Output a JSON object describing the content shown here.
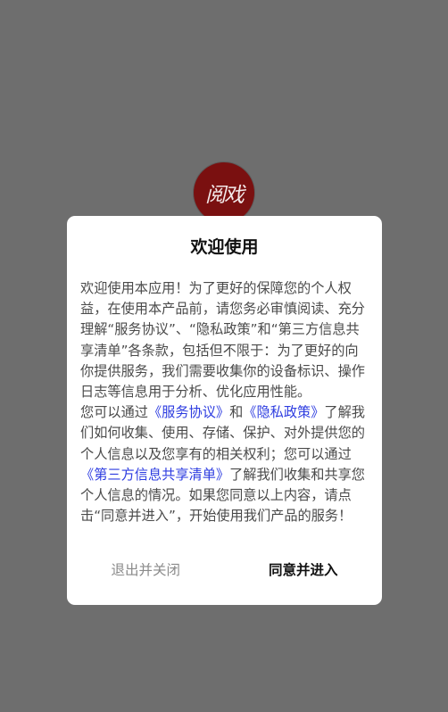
{
  "logo": {
    "text": "阅戏"
  },
  "dialog": {
    "title": "欢迎使用",
    "paragraph1": "欢迎使用本应用！为了更好的保障您的个人权益，在使用本产品前，请您务必审慎阅读、充分理解“服务协议”、“隐私政策”和“第三方信息共享清单”各条款，包括但不限于：为了更好的向你提供服务，我们需要收集你的设备标识、操作日志等信息用于分析、优化应用性能。",
    "p2_part1": "您可以通过",
    "link_service": "《服务协议》",
    "p2_part2": "和",
    "link_privacy": "《隐私政策》",
    "p2_part3": "了解我们如何收集、使用、存储、保护、对外提供您的个人信息以及您享有的相关权利；您可以通过",
    "link_third_party": "《第三方信息共享清单》",
    "p2_part4": "了解我们收集和共享您个人信息的情况。如果您同意以上内容，请点击“同意并进入”，开始使用我们产品的服务！",
    "exit_label": "退出并关闭",
    "agree_label": "同意并进入"
  },
  "colors": {
    "overlay": "#6e6e6e",
    "link": "#2d3ce0",
    "logo_bg": "#7a1010"
  }
}
